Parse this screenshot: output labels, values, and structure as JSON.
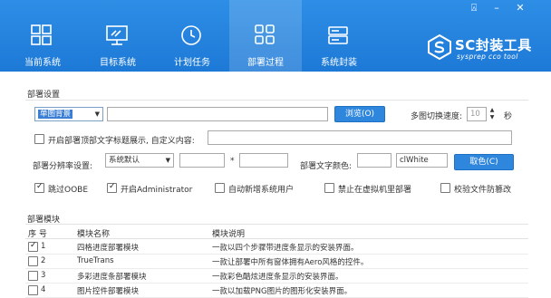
{
  "window_controls": {
    "pin": "⍓",
    "minimize": "–",
    "close": "✕"
  },
  "nav": {
    "tabs": [
      {
        "label": "当前系统",
        "icon": "windows-icon"
      },
      {
        "label": "目标系统",
        "icon": "monitor-icon"
      },
      {
        "label": "计划任务",
        "icon": "clock-icon"
      },
      {
        "label": "部署过程",
        "icon": "grid-icon",
        "active": true
      },
      {
        "label": "系统封装",
        "icon": "drive-icon"
      }
    ]
  },
  "brand": {
    "name": "SC封装工具",
    "subtitle": "sysprep cco tool"
  },
  "deploy": {
    "section_title": "部署设置",
    "background_mode": "单图背景",
    "image_path": "",
    "browse_label": "浏览(O)",
    "switch_speed_label": "多图切换速度:",
    "switch_speed_value": "10",
    "switch_speed_unit": "秒",
    "custom_text_checkbox": "开启部署顶部文字标题展示, 自定义内容:",
    "custom_text_value": "",
    "resolution_label": "部署分辨率设置:",
    "resolution_value": "系统默认",
    "resolution_w": "",
    "resolution_sep": "*",
    "resolution_h": "",
    "text_color_label": "部署文字颜色:",
    "text_color_swatch": "",
    "text_color_value": "clWhite",
    "pick_color_label": "取色(C)"
  },
  "options": [
    {
      "label": "跳过OOBE",
      "checked": true
    },
    {
      "label": "开启Administrator",
      "checked": true
    },
    {
      "label": "自动新增系统用户",
      "checked": false
    },
    {
      "label": "禁止在虚拟机里部署",
      "checked": false
    },
    {
      "label": "校验文件防篡改",
      "checked": false
    }
  ],
  "modules": {
    "section_title": "部署模块",
    "headers": {
      "seq": "序 号",
      "name": "模块名称",
      "desc": "模块说明"
    },
    "rows": [
      {
        "seq": "1",
        "checked": true,
        "name": "四格进度部署模块",
        "desc": "一款以四个步骤带进度条显示的安装界面。"
      },
      {
        "seq": "2",
        "checked": false,
        "name": "TrueTrans",
        "desc": "一款让部署中所有窗体拥有Aero风格的控件。"
      },
      {
        "seq": "3",
        "checked": false,
        "name": "多彩进度条部署模块",
        "desc": "一款彩色酷炫进度条显示的安装界面。"
      },
      {
        "seq": "4",
        "checked": false,
        "name": "图片控件部署模块",
        "desc": "一款以加载PNG图片的图形化安装界面。"
      }
    ]
  },
  "colors": {
    "header": "#1f7bd8",
    "button": "#2f86dd"
  }
}
